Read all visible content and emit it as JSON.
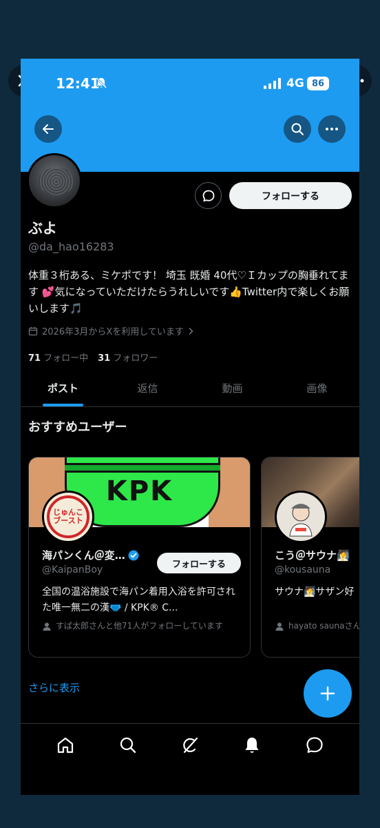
{
  "status_bar": {
    "time": "12:41",
    "network": "4G",
    "battery": "86"
  },
  "profile": {
    "name": "ぶよ",
    "handle": "@da_hao16283",
    "bio": "体重３桁ある、ミケポです！ 埼玉 既婚 40代♡Ｉカップの胸垂れてます 💕気になっていただけたらうれしいです👍Twitter内で楽しくお願いします🎵",
    "joined": "2026年3月からXを利用しています",
    "following_count": "71",
    "following_label": "フォロー中",
    "followers_count": "31",
    "followers_label": "フォロワー",
    "follow_label": "フォローする"
  },
  "tabs": [
    {
      "label": "ポスト"
    },
    {
      "label": "返信"
    },
    {
      "label": "動画"
    },
    {
      "label": "画像"
    }
  ],
  "recommended": {
    "title": "おすすめユーザー",
    "banner_text": "KPK",
    "avatar_text": "じゅんこブースト",
    "users": [
      {
        "name": "海パンくん＠変…",
        "handle": "@KaipanBoy",
        "follow_label": "フォローする",
        "description": "全国の温浴施設で海パン着用入浴を許可された唯一無二の漢🩲 / KPK® C...",
        "followed_by": "すぱ太郎さんと他71人がフォローしています"
      },
      {
        "name": "こう＠サウナ🧖",
        "handle": "@kousauna",
        "description": "サウナ🧖サザン好",
        "followed_by": "hayato saunaさんがフォローしています"
      }
    ],
    "show_more": "さらに表示"
  },
  "colors": {
    "accent": "#1d9bf0",
    "background": "#000000",
    "muted": "#71767b"
  },
  "icons": [
    "close-icon",
    "more-icon",
    "back-icon",
    "search-icon",
    "message-icon",
    "calendar-icon",
    "verified-icon",
    "person-icon",
    "plus-icon",
    "home-icon",
    "grok-icon",
    "bell-icon",
    "chat-icon"
  ]
}
